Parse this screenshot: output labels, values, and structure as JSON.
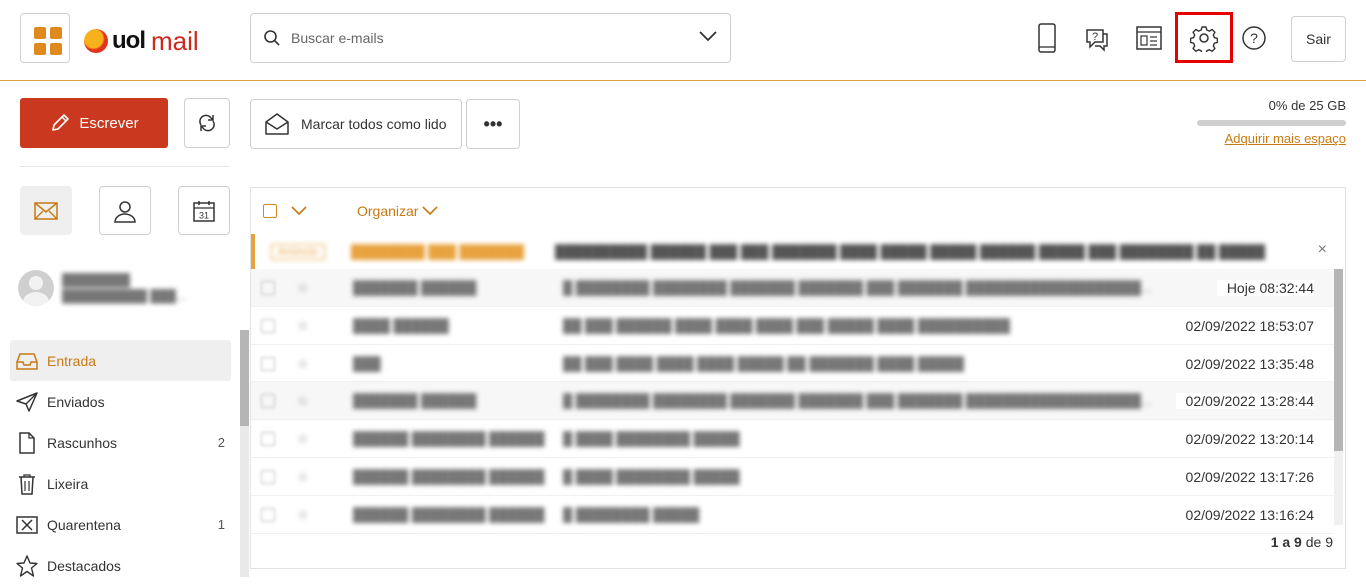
{
  "header": {
    "logo_brand": "uol",
    "logo_product": "mail",
    "search_placeholder": "Buscar e-mails",
    "logout_label": "Sair"
  },
  "toolbar": {
    "compose_label": "Escrever",
    "mark_all_read_label": "Marcar todos como lido",
    "more_label": "•••"
  },
  "quota": {
    "text": "0% de 25 GB",
    "used_fraction": 0.0,
    "link": "Adquirir mais espaço"
  },
  "sidebar": {
    "folders": [
      {
        "label": "Entrada",
        "count": "",
        "icon": "inbox-icon"
      },
      {
        "label": "Enviados",
        "count": "",
        "icon": "send-icon"
      },
      {
        "label": "Rascunhos",
        "count": "2",
        "icon": "draft-icon"
      },
      {
        "label": "Lixeira",
        "count": "",
        "icon": "trash-icon"
      },
      {
        "label": "Quarentena",
        "count": "1",
        "icon": "quarantine-icon"
      },
      {
        "label": "Destacados",
        "count": "",
        "icon": "star-icon"
      }
    ]
  },
  "list": {
    "organize_label": "Organizar",
    "close_label": "×",
    "dates": [
      "Hoje 08:32:44",
      "02/09/2022 18:53:07",
      "02/09/2022 13:35:48",
      "02/09/2022 13:28:44",
      "02/09/2022 13:20:14",
      "02/09/2022 13:17:26",
      "02/09/2022 13:16:24"
    ],
    "pager": {
      "range": "1 a 9",
      "of_label": "de",
      "total": "9"
    }
  },
  "colors": {
    "accent": "#c87a12",
    "compose": "#c9381f",
    "highlight_box": "#e60000"
  }
}
